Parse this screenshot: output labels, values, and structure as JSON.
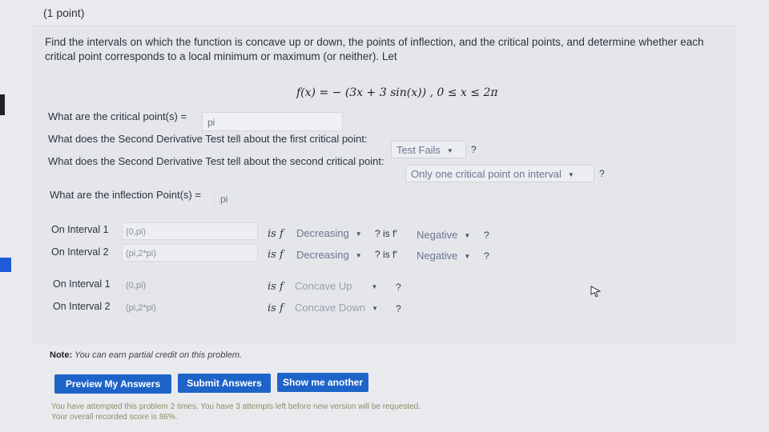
{
  "points": "(1 point)",
  "statement": "Find the intervals on which the function is concave up or down, the points of inflection, and the critical points, and determine whether each critical point corresponds to a local minimum or maximum (or neither). Let",
  "formula": "f(x) = − (3x + 3 sin(x)) , 0 ≤ x ≤ 2π",
  "critical": {
    "question": "What are the critical point(s) =",
    "value": "pi"
  },
  "second_test_1": {
    "question": "What does the Second Derivative Test tell about the first critical point:",
    "selected": "Test Fails",
    "help": "?"
  },
  "second_test_2": {
    "question": "What does the Second Derivative Test tell about the second critical point:",
    "selected": "Only one critical point on interval",
    "help": "?"
  },
  "inflection": {
    "question": "What are the inflection Point(s) =",
    "value": "pi"
  },
  "monotonic": [
    {
      "label": "On Interval 1",
      "interval": "(0,pi)",
      "is_f": "is f",
      "f_choice": "Decreasing",
      "mid": "? is f′",
      "fp_choice": "Negative",
      "help": "?"
    },
    {
      "label": "On Interval 2",
      "interval": "(pi,2*pi)",
      "is_f": "is f",
      "f_choice": "Decreasing",
      "mid": "? is f′",
      "fp_choice": "Negative",
      "help": "?"
    }
  ],
  "concavity": [
    {
      "label": "On Interval 1",
      "interval": "(0,pi)",
      "is_f": "is f",
      "choice": "Concave Up",
      "help": "?"
    },
    {
      "label": "On Interval 2",
      "interval": "(pi,2*pi)",
      "is_f": "is f",
      "choice": "Concave Down",
      "help": "?"
    }
  ],
  "note": {
    "bold": "Note:",
    "text": "You can earn partial credit on this problem."
  },
  "buttons": {
    "preview": "Preview My Answers",
    "submit": "Submit Answers",
    "another": "Show me another"
  },
  "attempts": {
    "line1": "You have attempted this problem 2 times. You have 3 attempts left before new version will be requested.",
    "line2": "Your overall recorded score is 86%."
  },
  "colors": {
    "button": "#1e64c8",
    "accent": "#1e5bd8"
  }
}
